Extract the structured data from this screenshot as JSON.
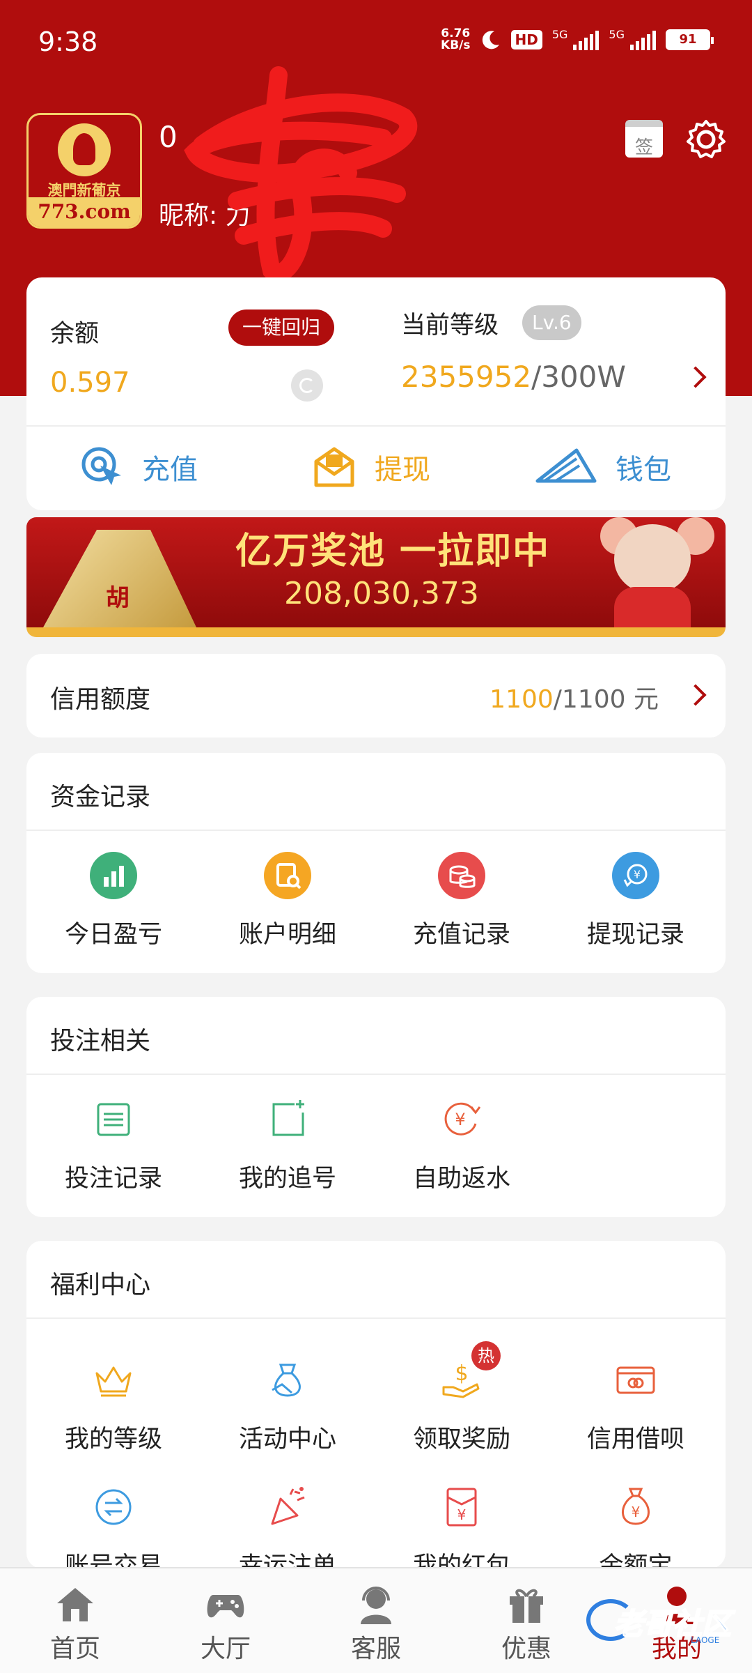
{
  "status_bar": {
    "time": "9:38",
    "net_speed_value": "6.76",
    "net_speed_unit": "KB/s",
    "hd": "HD",
    "sim1": "5G",
    "sim2": "5G",
    "battery": "91"
  },
  "profile": {
    "logo_line1": "澳門新葡京",
    "logo_line2": "773.com",
    "username": "0",
    "nickname": "昵称: 力"
  },
  "header_buttons": {
    "sign": "签"
  },
  "balance": {
    "label": "余额",
    "recall_button": "一键回归",
    "value": "0.597",
    "level_label": "当前等级",
    "level_badge": "Lv.6",
    "level_progress_current": "2355952",
    "level_progress_target": "/300W"
  },
  "actions": [
    {
      "label": "充值",
      "icon": "recharge-icon"
    },
    {
      "label": "提现",
      "icon": "withdraw-icon"
    },
    {
      "label": "钱包",
      "icon": "wallet-icon"
    }
  ],
  "banner": {
    "title": "亿万奖池 一拉即中",
    "amount": "208,030,373",
    "tile_text": "胡"
  },
  "credit": {
    "label": "信用额度",
    "used": "1100",
    "total": "/1100 元"
  },
  "money_records": {
    "title": "资金记录",
    "items": [
      {
        "label": "今日盈亏",
        "icon": "chart-icon",
        "color": "#3fb07a"
      },
      {
        "label": "账户明细",
        "icon": "receipt-search-icon",
        "color": "#f5a623"
      },
      {
        "label": "充值记录",
        "icon": "coins-icon",
        "color": "#e74c4c"
      },
      {
        "label": "提现记录",
        "icon": "yuan-exchange-icon",
        "color": "#3d9be0"
      }
    ]
  },
  "betting": {
    "title": "投注相关",
    "items": [
      {
        "label": "投注记录",
        "icon": "list-icon",
        "color": "#3fb07a"
      },
      {
        "label": "我的追号",
        "icon": "add-note-icon",
        "color": "#3fb07a"
      },
      {
        "label": "自助返水",
        "icon": "yuan-rebate-icon",
        "color": "#e8603c"
      }
    ]
  },
  "welfare": {
    "title": "福利中心",
    "hot_badge": "热",
    "items": [
      {
        "label": "我的等级",
        "icon": "crown-icon",
        "color": "#f0a81e"
      },
      {
        "label": "活动中心",
        "icon": "gift-bag-icon",
        "color": "#3d9be0"
      },
      {
        "label": "领取奖励",
        "icon": "hand-dollar-icon",
        "color": "#f0a81e"
      },
      {
        "label": "信用借呗",
        "icon": "card-icon",
        "color": "#e8603c"
      },
      {
        "label": "账号交易",
        "icon": "swap-icon",
        "color": "#3d9be0"
      },
      {
        "label": "幸运注单",
        "icon": "party-icon",
        "color": "#e74c4c"
      },
      {
        "label": "我的红包",
        "icon": "red-envelope-icon",
        "color": "#e74c4c"
      },
      {
        "label": "余额宝",
        "icon": "money-bag-icon",
        "color": "#e8603c"
      }
    ]
  },
  "tabbar": [
    {
      "label": "首页",
      "icon": "home-icon"
    },
    {
      "label": "大厅",
      "icon": "gamepad-icon"
    },
    {
      "label": "客服",
      "icon": "support-icon"
    },
    {
      "label": "优惠",
      "icon": "gift-icon"
    },
    {
      "label": "我的",
      "icon": "user-icon",
      "active": true
    }
  ],
  "watermark": {
    "text": "老哥社区",
    "sub": "LAOGE"
  },
  "colors": {
    "brand_red": "#b00d0d",
    "accent_gold": "#f0a81e",
    "accent_blue": "#3d8fd1"
  }
}
